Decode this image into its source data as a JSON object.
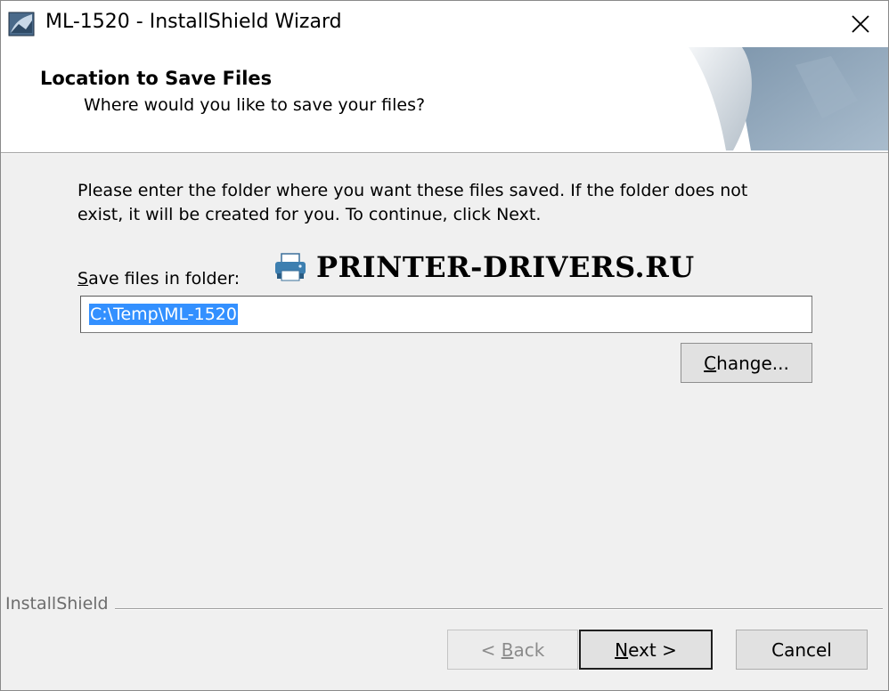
{
  "window": {
    "title": "ML-1520 - InstallShield Wizard"
  },
  "header": {
    "title": "Location to Save Files",
    "subtitle": "Where would you like to save your files?"
  },
  "body": {
    "description": "Please enter the folder where you want these files saved.  If the folder does not\nexist, it will be created for you.   To continue, click Next.",
    "folder_label_accel": "S",
    "folder_label_rest": "ave files in folder:",
    "folder_value": "C:\\Temp\\ML-1520",
    "watermark": "PRINTER-DRIVERS.RU"
  },
  "buttons": {
    "change_accel": "C",
    "change_rest": "hange...",
    "back_prefix": "< ",
    "back_accel": "B",
    "back_rest": "ack",
    "next_accel": "N",
    "next_rest": "ext >",
    "cancel": "Cancel"
  },
  "footer": {
    "brand": "InstallShield"
  },
  "icons": {
    "app": "installshield-app-icon",
    "close": "close-icon",
    "printer": "printer-icon"
  },
  "colors": {
    "selection": "#3390ff",
    "window_bg": "#f0f0f0",
    "header_bg": "#ffffff"
  }
}
